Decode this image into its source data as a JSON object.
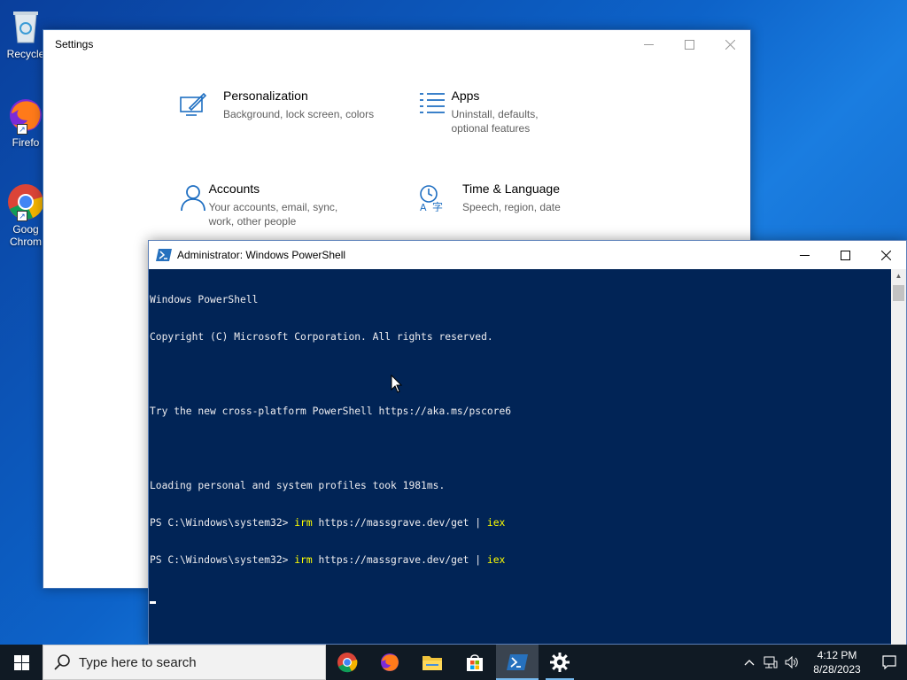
{
  "desktop": {
    "icons": [
      {
        "label": "Recycle",
        "icon": "recycle-bin-icon"
      },
      {
        "label": "Firefo",
        "icon": "firefox-icon"
      },
      {
        "label": "Goog Chrom",
        "icon": "chrome-icon",
        "line1": "Goog",
        "line2": "Chrom"
      }
    ]
  },
  "settings": {
    "title": "Settings",
    "items": [
      {
        "name": "Personalization",
        "desc": "Background, lock screen, colors",
        "icon": "personalization-icon"
      },
      {
        "name": "Apps",
        "desc": "Uninstall, defaults, optional features",
        "icon": "apps-list-icon"
      },
      {
        "name": "Accounts",
        "desc": "Your accounts, email, sync, work, other people",
        "icon": "person-icon"
      },
      {
        "name": "Time & Language",
        "desc": "Speech, region, date",
        "icon": "time-language-icon"
      }
    ]
  },
  "powershell": {
    "title": "Administrator: Windows PowerShell",
    "lines": [
      {
        "text": "Windows PowerShell"
      },
      {
        "text": "Copyright (C) Microsoft Corporation. All rights reserved."
      },
      {
        "text": ""
      },
      {
        "text": "Try the new cross-platform PowerShell https://aka.ms/pscore6"
      },
      {
        "text": ""
      },
      {
        "text": "Loading personal and system profiles took 1981ms."
      },
      {
        "prompt": "PS C:\\Windows\\system32> ",
        "cmd1": "irm",
        "arg": " https://massgrave.dev/get ",
        "pipe": "| ",
        "cmd2": "iex"
      },
      {
        "prompt": "PS C:\\Windows\\system32> ",
        "cmd1": "irm",
        "arg": " https://massgrave.dev/get ",
        "pipe": "| ",
        "cmd2": "iex"
      }
    ],
    "colors": {
      "background": "#012456",
      "text": "#eeedf0",
      "command": "#ffff00"
    }
  },
  "taskbar": {
    "search_placeholder": "Type here to search",
    "apps": [
      "chrome-icon",
      "firefox-icon",
      "file-explorer-icon",
      "store-icon",
      "powershell-icon",
      "settings-gear-icon"
    ],
    "clock": {
      "time": "4:12 PM",
      "date": "8/28/2023"
    }
  }
}
